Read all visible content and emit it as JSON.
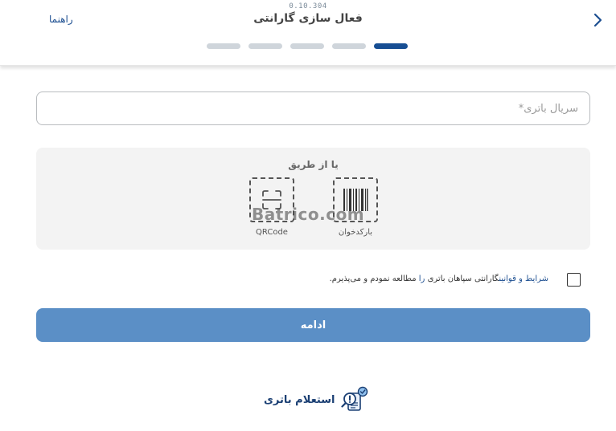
{
  "header": {
    "version": "0.10.304",
    "title": "فعال سازی گارانتی",
    "help_label": "راهنما",
    "steps_total": 5,
    "steps_active": 1,
    "accent_color": "#174e93",
    "back_icon": "chevron-right-icon"
  },
  "serial": {
    "placeholder": "سریال باتری*",
    "value": ""
  },
  "scan": {
    "or_label": "یا از طریق",
    "qr_label": "QRCode",
    "qr_icon": "qr-scan-icon",
    "barcode_label": "بارکدخوان",
    "barcode_icon": "barcode-icon",
    "watermark": "Batrico.com"
  },
  "terms": {
    "checked": false,
    "link_text": "شرایط و قوانین",
    "middle_text": "گارانتی سپاهان باتری ",
    "brand_word": "را",
    "end_text": " مطالعه نمودم و می‌پذیرم."
  },
  "continue_label": "ادامه",
  "continue_color": "#5b8fc6",
  "inquiry": {
    "label": "استعلام باتری",
    "icon": "battery-inquiry-icon"
  }
}
